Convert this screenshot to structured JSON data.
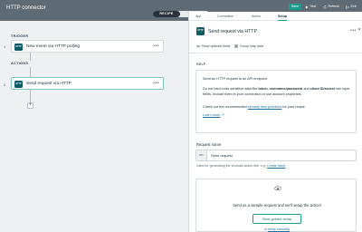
{
  "app": {
    "title": "HTTP connector"
  },
  "modes": {
    "recipe": "RECIPE",
    "test_jobs": "TEST JOBS"
  },
  "toolbar": {
    "save": "Save",
    "test": "Test",
    "refresh": "Refresh",
    "exit": "Exit"
  },
  "canvas": {
    "trigger_label": "TRIGGER",
    "actions_label": "ACTIONS",
    "steps": [
      {
        "number": "1",
        "icon_text": "HTTP",
        "title": "New event via HTTP polling",
        "more": "•••"
      },
      {
        "number": "2",
        "icon_text": "HTTP",
        "title": "Send request via HTTP",
        "more": "•••"
      }
    ],
    "add_symbol": "+"
  },
  "panel": {
    "tabs": [
      "App",
      "Connection",
      "Action",
      "Setup"
    ],
    "active_tab": "Setup",
    "tab_separator": "›",
    "icon_text": "HTTP",
    "title": "Send request via HTTP",
    "more": "•••",
    "close": "✕",
    "show_optional_fields": "Show optional fields",
    "group_map_data": "Group map data",
    "help_label": "HELP",
    "help": {
      "p1": "Send an HTTP request to an API endpoint.",
      "p2_a": "Do not hard-code sensitive data like ",
      "p2_b": "token, username/password",
      "p2_c": " and ",
      "p2_d": "client ID/secret",
      "p2_e": " into input fields. Include them in your connection or use account properties.",
      "p3_a": "Check out the recommended ",
      "p3_link": "security best practices",
      "p3_b": " for your recipe.",
      "learn_more": "Learn more"
    },
    "request_name_label": "Request name",
    "request_name_badge": "ABC",
    "request_name_value": "Send request",
    "request_hint": "Used for generating the Workato action title, e.g. ",
    "request_hint_link": "Create ticket",
    "setup_text": "Send us a sample request and we'll setup the action!",
    "guided_button": "Start guided setup",
    "or_text": "or ",
    "manual_link": "setup manually"
  },
  "colors": {
    "accent": "#1e9c8c",
    "topbar": "#5f6b74",
    "http_icon": "#0f5b67",
    "link": "#1f6f9e"
  }
}
